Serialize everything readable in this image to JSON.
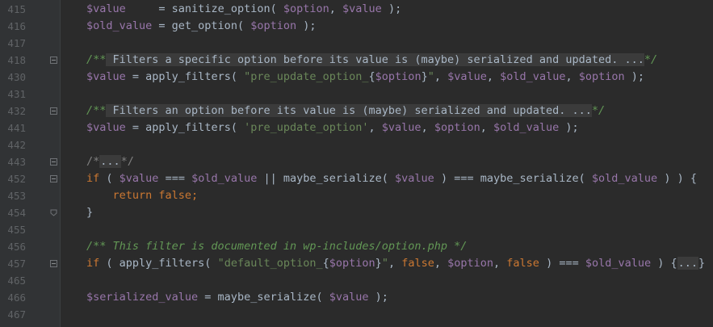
{
  "editor": {
    "lines": [
      {
        "num": "415",
        "fold": "",
        "tokens": [
          {
            "t": "var",
            "v": "$value"
          },
          {
            "t": "plain",
            "v": "     = sanitize_option( "
          },
          {
            "t": "var",
            "v": "$option"
          },
          {
            "t": "plain",
            "v": ", "
          },
          {
            "t": "var",
            "v": "$value"
          },
          {
            "t": "plain",
            "v": " );"
          }
        ]
      },
      {
        "num": "416",
        "fold": "",
        "tokens": [
          {
            "t": "var",
            "v": "$old_value"
          },
          {
            "t": "plain",
            "v": " = get_option( "
          },
          {
            "t": "var",
            "v": "$option"
          },
          {
            "t": "plain",
            "v": " );"
          }
        ]
      },
      {
        "num": "417",
        "fold": "",
        "tokens": []
      },
      {
        "num": "418",
        "fold": "open",
        "tokens": [
          {
            "t": "cmt",
            "v": "/**"
          },
          {
            "t": "collapsed-doc",
            "v": " Filters a specific option before its value is (maybe) serialized and updated. ..."
          },
          {
            "t": "cmt",
            "v": "*/"
          }
        ]
      },
      {
        "num": "430",
        "fold": "",
        "tokens": [
          {
            "t": "var",
            "v": "$value"
          },
          {
            "t": "plain",
            "v": " = apply_filters( "
          },
          {
            "t": "str",
            "v": "\"pre_update_option_"
          },
          {
            "t": "plain",
            "v": "{"
          },
          {
            "t": "var",
            "v": "$option"
          },
          {
            "t": "plain",
            "v": "}"
          },
          {
            "t": "str",
            "v": "\""
          },
          {
            "t": "plain",
            "v": ", "
          },
          {
            "t": "var",
            "v": "$value"
          },
          {
            "t": "plain",
            "v": ", "
          },
          {
            "t": "var",
            "v": "$old_value"
          },
          {
            "t": "plain",
            "v": ", "
          },
          {
            "t": "var",
            "v": "$option"
          },
          {
            "t": "plain",
            "v": " );"
          }
        ]
      },
      {
        "num": "431",
        "fold": "",
        "tokens": []
      },
      {
        "num": "432",
        "fold": "open",
        "tokens": [
          {
            "t": "cmt",
            "v": "/**"
          },
          {
            "t": "collapsed-doc",
            "v": " Filters an option before its value is (maybe) serialized and updated. ..."
          },
          {
            "t": "cmt",
            "v": "*/"
          }
        ]
      },
      {
        "num": "441",
        "fold": "",
        "tokens": [
          {
            "t": "var",
            "v": "$value"
          },
          {
            "t": "plain",
            "v": " = apply_filters( "
          },
          {
            "t": "str",
            "v": "'pre_update_option'"
          },
          {
            "t": "plain",
            "v": ", "
          },
          {
            "t": "var",
            "v": "$value"
          },
          {
            "t": "plain",
            "v": ", "
          },
          {
            "t": "var",
            "v": "$option"
          },
          {
            "t": "plain",
            "v": ", "
          },
          {
            "t": "var",
            "v": "$old_value"
          },
          {
            "t": "plain",
            "v": " );"
          }
        ]
      },
      {
        "num": "442",
        "fold": "",
        "tokens": []
      },
      {
        "num": "443",
        "fold": "open",
        "tokens": [
          {
            "t": "dim",
            "v": "/*"
          },
          {
            "t": "collapsed",
            "v": "..."
          },
          {
            "t": "dim",
            "v": "*/"
          }
        ]
      },
      {
        "num": "452",
        "fold": "open",
        "tokens": [
          {
            "t": "kw",
            "v": "if"
          },
          {
            "t": "plain",
            "v": " ( "
          },
          {
            "t": "var",
            "v": "$value"
          },
          {
            "t": "plain",
            "v": " === "
          },
          {
            "t": "var",
            "v": "$old_value"
          },
          {
            "t": "plain",
            "v": " || maybe_serialize( "
          },
          {
            "t": "var",
            "v": "$value"
          },
          {
            "t": "plain",
            "v": " ) === maybe_serialize( "
          },
          {
            "t": "var",
            "v": "$old_value"
          },
          {
            "t": "plain",
            "v": " ) ) {"
          }
        ]
      },
      {
        "num": "453",
        "fold": "",
        "tokens": [
          {
            "t": "plain",
            "v": "    "
          },
          {
            "t": "kw",
            "v": "return false;"
          }
        ]
      },
      {
        "num": "454",
        "fold": "end",
        "tokens": [
          {
            "t": "plain",
            "v": "}"
          }
        ]
      },
      {
        "num": "455",
        "fold": "",
        "tokens": []
      },
      {
        "num": "456",
        "fold": "",
        "tokens": [
          {
            "t": "cmt",
            "v": "/** This filter is documented in wp-includes/option.php */"
          }
        ]
      },
      {
        "num": "457",
        "fold": "open",
        "tokens": [
          {
            "t": "kw",
            "v": "if"
          },
          {
            "t": "plain",
            "v": " ( apply_filters( "
          },
          {
            "t": "str",
            "v": "\"default_option_"
          },
          {
            "t": "plain",
            "v": "{"
          },
          {
            "t": "var",
            "v": "$option"
          },
          {
            "t": "plain",
            "v": "}"
          },
          {
            "t": "str",
            "v": "\""
          },
          {
            "t": "plain",
            "v": ", "
          },
          {
            "t": "kw",
            "v": "false"
          },
          {
            "t": "plain",
            "v": ", "
          },
          {
            "t": "var",
            "v": "$option"
          },
          {
            "t": "plain",
            "v": ", "
          },
          {
            "t": "kw",
            "v": "false"
          },
          {
            "t": "plain",
            "v": " ) === "
          },
          {
            "t": "var",
            "v": "$old_value"
          },
          {
            "t": "plain",
            "v": " ) {"
          },
          {
            "t": "collapsed",
            "v": "..."
          },
          {
            "t": "plain",
            "v": "}"
          }
        ]
      },
      {
        "num": "465",
        "fold": "",
        "tokens": []
      },
      {
        "num": "466",
        "fold": "",
        "tokens": [
          {
            "t": "var",
            "v": "$serialized_value"
          },
          {
            "t": "plain",
            "v": " = maybe_serialize( "
          },
          {
            "t": "var",
            "v": "$value"
          },
          {
            "t": "plain",
            "v": " );"
          }
        ]
      },
      {
        "num": "467",
        "fold": "",
        "tokens": []
      }
    ]
  },
  "colors": {
    "background": "#2b2b2b",
    "gutter": "#313335",
    "variable": "#9876aa",
    "string": "#6a8759",
    "keyword": "#cc7832",
    "comment": "#629755",
    "plain": "#a9b7c6"
  }
}
